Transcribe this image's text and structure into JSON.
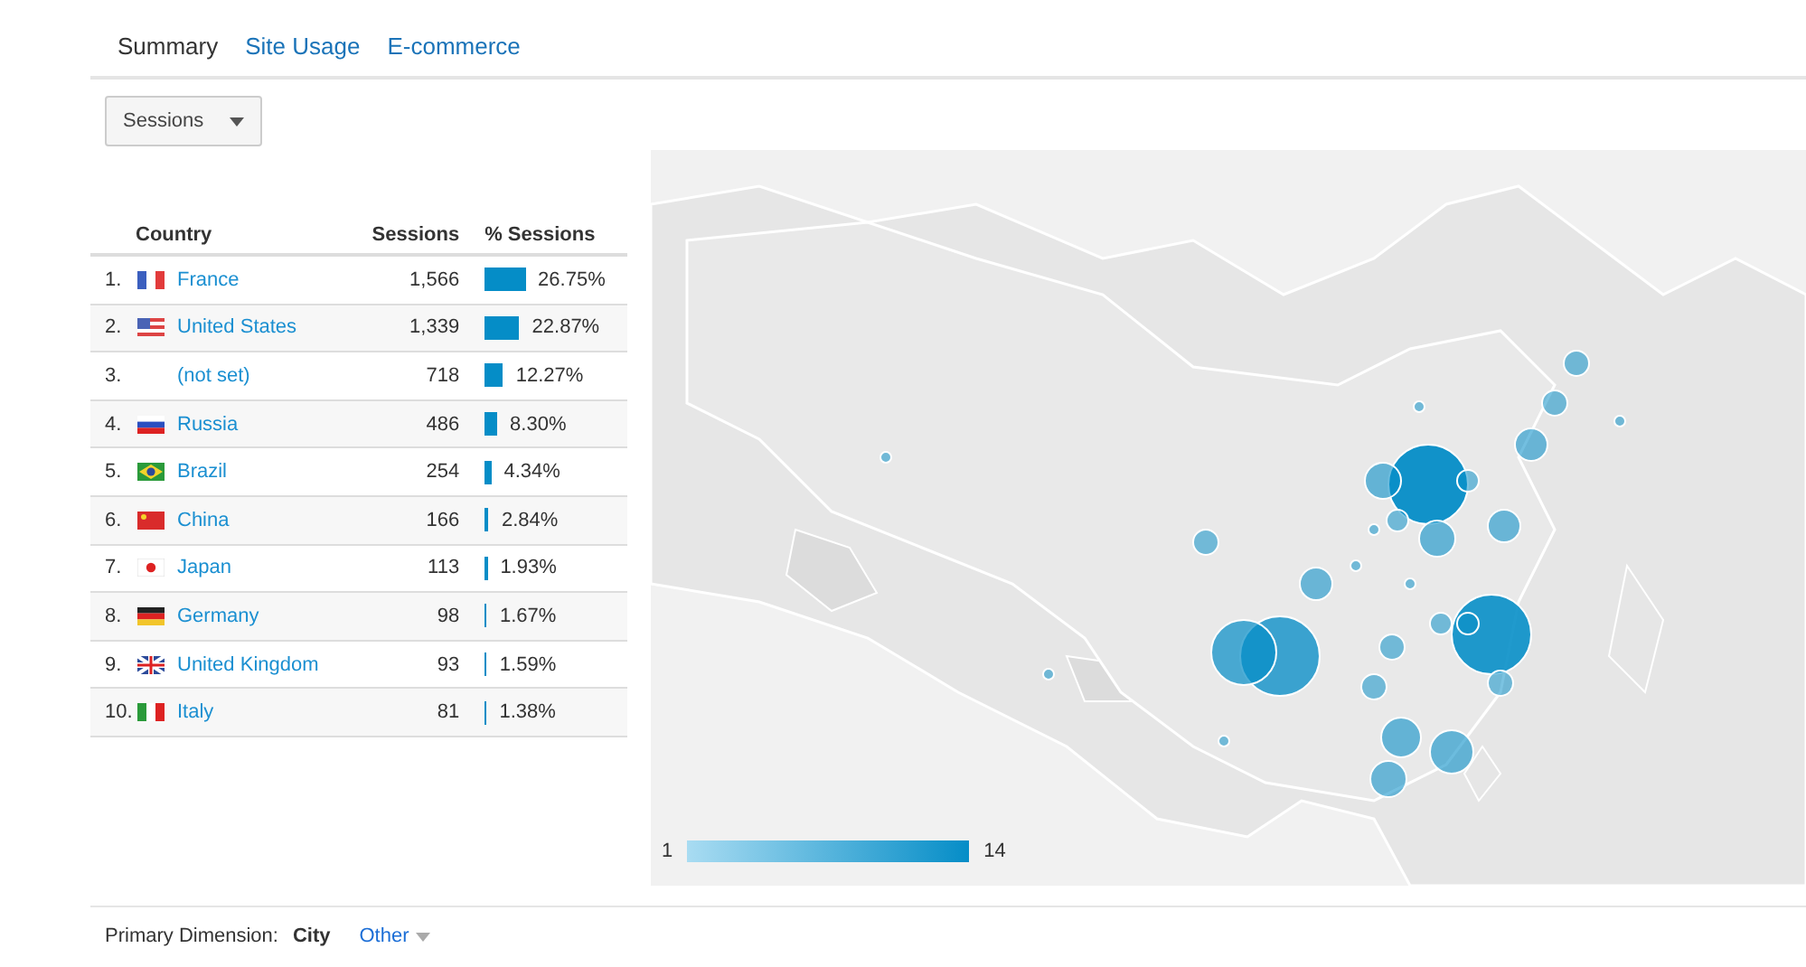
{
  "tabs": [
    {
      "label": "Summary",
      "selected": true
    },
    {
      "label": "Site Usage",
      "selected": false
    },
    {
      "label": "E-commerce",
      "selected": false
    }
  ],
  "metric_dropdown": {
    "label": "Sessions"
  },
  "table": {
    "columns": [
      "Country",
      "Sessions",
      "% Sessions"
    ],
    "rows": [
      {
        "rank": "1.",
        "kind": "fr",
        "country": "France",
        "sessions": "1,566",
        "level": 0.2675,
        "percent": "26.75%"
      },
      {
        "rank": "2.",
        "kind": "us",
        "country": "United States",
        "sessions": "1,339",
        "level": 0.2287,
        "percent": "22.87%"
      },
      {
        "rank": "3.",
        "kind": "none",
        "country": "(not set)",
        "sessions": "718",
        "level": 0.1227,
        "percent": "12.27%"
      },
      {
        "rank": "4.",
        "kind": "ru",
        "country": "Russia",
        "sessions": "486",
        "level": 0.083,
        "percent": "8.30%"
      },
      {
        "rank": "5.",
        "kind": "br",
        "country": "Brazil",
        "sessions": "254",
        "level": 0.0434,
        "percent": "4.34%"
      },
      {
        "rank": "6.",
        "kind": "cn",
        "country": "China",
        "sessions": "166",
        "level": 0.0284,
        "percent": "2.84%"
      },
      {
        "rank": "7.",
        "kind": "jp",
        "country": "Japan",
        "sessions": "113",
        "level": 0.0193,
        "percent": "1.93%"
      },
      {
        "rank": "8.",
        "kind": "de",
        "country": "Germany",
        "sessions": "98",
        "level": 0.0167,
        "percent": "1.67%"
      },
      {
        "rank": "9.",
        "kind": "gb",
        "country": "United Kingdom",
        "sessions": "93",
        "level": 0.0159,
        "percent": "1.59%"
      },
      {
        "rank": "10.",
        "kind": "it",
        "country": "Italy",
        "sessions": "81",
        "level": 0.0138,
        "percent": "1.38%"
      }
    ]
  },
  "map": {
    "legend": {
      "min": "1",
      "max": "14"
    }
  },
  "footer": {
    "label": "Primary Dimension:",
    "selected": "City",
    "other": "Other"
  }
}
